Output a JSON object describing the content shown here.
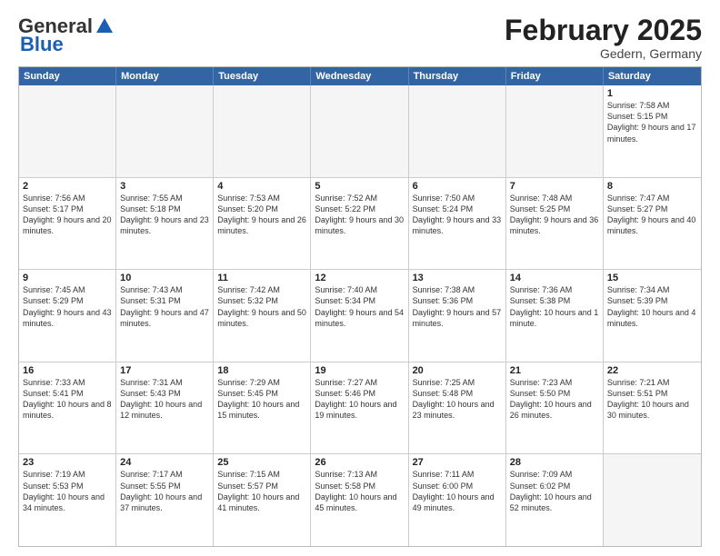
{
  "header": {
    "logo_general": "General",
    "logo_blue": "Blue",
    "month": "February 2025",
    "location": "Gedern, Germany"
  },
  "weekdays": [
    "Sunday",
    "Monday",
    "Tuesday",
    "Wednesday",
    "Thursday",
    "Friday",
    "Saturday"
  ],
  "rows": [
    [
      {
        "day": "",
        "info": ""
      },
      {
        "day": "",
        "info": ""
      },
      {
        "day": "",
        "info": ""
      },
      {
        "day": "",
        "info": ""
      },
      {
        "day": "",
        "info": ""
      },
      {
        "day": "",
        "info": ""
      },
      {
        "day": "1",
        "info": "Sunrise: 7:58 AM\nSunset: 5:15 PM\nDaylight: 9 hours and 17 minutes."
      }
    ],
    [
      {
        "day": "2",
        "info": "Sunrise: 7:56 AM\nSunset: 5:17 PM\nDaylight: 9 hours and 20 minutes."
      },
      {
        "day": "3",
        "info": "Sunrise: 7:55 AM\nSunset: 5:18 PM\nDaylight: 9 hours and 23 minutes."
      },
      {
        "day": "4",
        "info": "Sunrise: 7:53 AM\nSunset: 5:20 PM\nDaylight: 9 hours and 26 minutes."
      },
      {
        "day": "5",
        "info": "Sunrise: 7:52 AM\nSunset: 5:22 PM\nDaylight: 9 hours and 30 minutes."
      },
      {
        "day": "6",
        "info": "Sunrise: 7:50 AM\nSunset: 5:24 PM\nDaylight: 9 hours and 33 minutes."
      },
      {
        "day": "7",
        "info": "Sunrise: 7:48 AM\nSunset: 5:25 PM\nDaylight: 9 hours and 36 minutes."
      },
      {
        "day": "8",
        "info": "Sunrise: 7:47 AM\nSunset: 5:27 PM\nDaylight: 9 hours and 40 minutes."
      }
    ],
    [
      {
        "day": "9",
        "info": "Sunrise: 7:45 AM\nSunset: 5:29 PM\nDaylight: 9 hours and 43 minutes."
      },
      {
        "day": "10",
        "info": "Sunrise: 7:43 AM\nSunset: 5:31 PM\nDaylight: 9 hours and 47 minutes."
      },
      {
        "day": "11",
        "info": "Sunrise: 7:42 AM\nSunset: 5:32 PM\nDaylight: 9 hours and 50 minutes."
      },
      {
        "day": "12",
        "info": "Sunrise: 7:40 AM\nSunset: 5:34 PM\nDaylight: 9 hours and 54 minutes."
      },
      {
        "day": "13",
        "info": "Sunrise: 7:38 AM\nSunset: 5:36 PM\nDaylight: 9 hours and 57 minutes."
      },
      {
        "day": "14",
        "info": "Sunrise: 7:36 AM\nSunset: 5:38 PM\nDaylight: 10 hours and 1 minute."
      },
      {
        "day": "15",
        "info": "Sunrise: 7:34 AM\nSunset: 5:39 PM\nDaylight: 10 hours and 4 minutes."
      }
    ],
    [
      {
        "day": "16",
        "info": "Sunrise: 7:33 AM\nSunset: 5:41 PM\nDaylight: 10 hours and 8 minutes."
      },
      {
        "day": "17",
        "info": "Sunrise: 7:31 AM\nSunset: 5:43 PM\nDaylight: 10 hours and 12 minutes."
      },
      {
        "day": "18",
        "info": "Sunrise: 7:29 AM\nSunset: 5:45 PM\nDaylight: 10 hours and 15 minutes."
      },
      {
        "day": "19",
        "info": "Sunrise: 7:27 AM\nSunset: 5:46 PM\nDaylight: 10 hours and 19 minutes."
      },
      {
        "day": "20",
        "info": "Sunrise: 7:25 AM\nSunset: 5:48 PM\nDaylight: 10 hours and 23 minutes."
      },
      {
        "day": "21",
        "info": "Sunrise: 7:23 AM\nSunset: 5:50 PM\nDaylight: 10 hours and 26 minutes."
      },
      {
        "day": "22",
        "info": "Sunrise: 7:21 AM\nSunset: 5:51 PM\nDaylight: 10 hours and 30 minutes."
      }
    ],
    [
      {
        "day": "23",
        "info": "Sunrise: 7:19 AM\nSunset: 5:53 PM\nDaylight: 10 hours and 34 minutes."
      },
      {
        "day": "24",
        "info": "Sunrise: 7:17 AM\nSunset: 5:55 PM\nDaylight: 10 hours and 37 minutes."
      },
      {
        "day": "25",
        "info": "Sunrise: 7:15 AM\nSunset: 5:57 PM\nDaylight: 10 hours and 41 minutes."
      },
      {
        "day": "26",
        "info": "Sunrise: 7:13 AM\nSunset: 5:58 PM\nDaylight: 10 hours and 45 minutes."
      },
      {
        "day": "27",
        "info": "Sunrise: 7:11 AM\nSunset: 6:00 PM\nDaylight: 10 hours and 49 minutes."
      },
      {
        "day": "28",
        "info": "Sunrise: 7:09 AM\nSunset: 6:02 PM\nDaylight: 10 hours and 52 minutes."
      },
      {
        "day": "",
        "info": ""
      }
    ]
  ]
}
